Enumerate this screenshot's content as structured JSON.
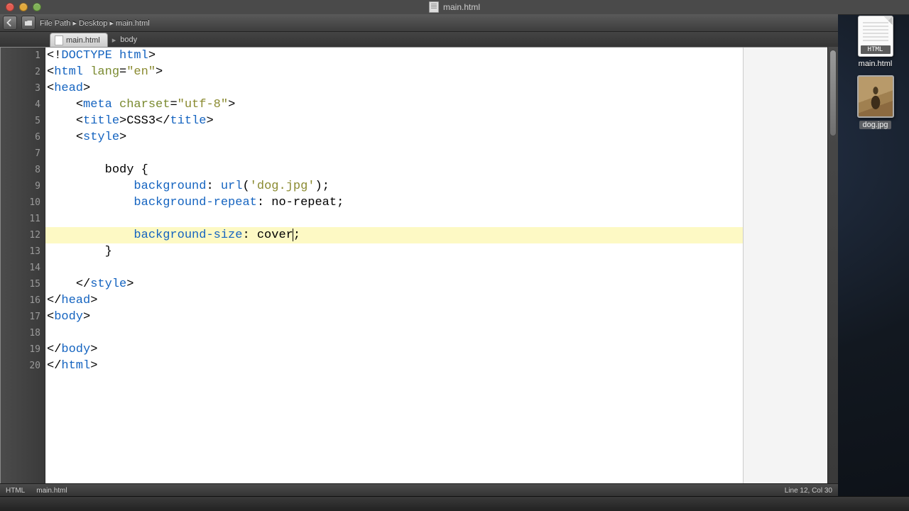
{
  "window": {
    "title": "main.html",
    "path": "File Path ▸ Desktop ▸ main.html"
  },
  "tabs": [
    {
      "label": "main.html"
    }
  ],
  "breadcrumb": "body",
  "desktop": {
    "file_badge": "HTML",
    "file_label": "main.html",
    "image_label": "dog.jpg"
  },
  "status": {
    "left1": "HTML",
    "left2": "main.html",
    "right": "Line 12, Col 30"
  },
  "code": {
    "highlighted_index": 11,
    "lines": [
      [
        {
          "t": "<!",
          "c": "lt"
        },
        {
          "t": "DOCTYPE html",
          "c": "s-tag"
        },
        {
          "t": ">",
          "c": "gt"
        }
      ],
      [
        {
          "t": "<",
          "c": "lt"
        },
        {
          "t": "html",
          "c": "s-tag"
        },
        {
          "t": " "
        },
        {
          "t": "lang",
          "c": "s-attr"
        },
        {
          "t": "="
        },
        {
          "t": "\"en\"",
          "c": "s-str"
        },
        {
          "t": ">",
          "c": "gt"
        }
      ],
      [
        {
          "t": "<",
          "c": "lt"
        },
        {
          "t": "head",
          "c": "s-tag"
        },
        {
          "t": ">",
          "c": "gt"
        }
      ],
      [
        {
          "t": "    "
        },
        {
          "t": "<",
          "c": "lt"
        },
        {
          "t": "meta",
          "c": "s-tag"
        },
        {
          "t": " "
        },
        {
          "t": "charset",
          "c": "s-attr"
        },
        {
          "t": "="
        },
        {
          "t": "\"utf-8\"",
          "c": "s-str"
        },
        {
          "t": ">",
          "c": "gt"
        }
      ],
      [
        {
          "t": "    "
        },
        {
          "t": "<",
          "c": "lt"
        },
        {
          "t": "title",
          "c": "s-tag"
        },
        {
          "t": ">",
          "c": "gt"
        },
        {
          "t": "CSS3"
        },
        {
          "t": "</",
          "c": "lt"
        },
        {
          "t": "title",
          "c": "s-tag"
        },
        {
          "t": ">",
          "c": "gt"
        }
      ],
      [
        {
          "t": "    "
        },
        {
          "t": "<",
          "c": "lt"
        },
        {
          "t": "style",
          "c": "s-tag"
        },
        {
          "t": ">",
          "c": "gt"
        }
      ],
      [],
      [
        {
          "t": "        "
        },
        {
          "t": "body",
          "c": "s-sel"
        },
        {
          "t": " {"
        }
      ],
      [
        {
          "t": "            "
        },
        {
          "t": "background",
          "c": "s-prop"
        },
        {
          "t": ": "
        },
        {
          "t": "url",
          "c": "s-tag"
        },
        {
          "t": "("
        },
        {
          "t": "'dog.jpg'",
          "c": "s-str"
        },
        {
          "t": ");"
        }
      ],
      [
        {
          "t": "            "
        },
        {
          "t": "background-repeat",
          "c": "s-prop"
        },
        {
          "t": ": no-repeat;"
        }
      ],
      [],
      [
        {
          "t": "            "
        },
        {
          "t": "background-size",
          "c": "s-prop"
        },
        {
          "t": ": cover"
        },
        {
          "t": "|",
          "cursor": true
        },
        {
          "t": ";"
        }
      ],
      [
        {
          "t": "        }"
        }
      ],
      [],
      [
        {
          "t": "    "
        },
        {
          "t": "</",
          "c": "lt"
        },
        {
          "t": "style",
          "c": "s-tag"
        },
        {
          "t": ">",
          "c": "gt"
        }
      ],
      [
        {
          "t": "</",
          "c": "lt"
        },
        {
          "t": "head",
          "c": "s-tag"
        },
        {
          "t": ">",
          "c": "gt"
        }
      ],
      [
        {
          "t": "<",
          "c": "lt"
        },
        {
          "t": "body",
          "c": "s-tag"
        },
        {
          "t": ">",
          "c": "gt"
        }
      ],
      [],
      [
        {
          "t": "</",
          "c": "lt"
        },
        {
          "t": "body",
          "c": "s-tag"
        },
        {
          "t": ">",
          "c": "gt"
        }
      ],
      [
        {
          "t": "</",
          "c": "lt"
        },
        {
          "t": "html",
          "c": "s-tag"
        },
        {
          "t": ">",
          "c": "gt"
        }
      ]
    ]
  }
}
